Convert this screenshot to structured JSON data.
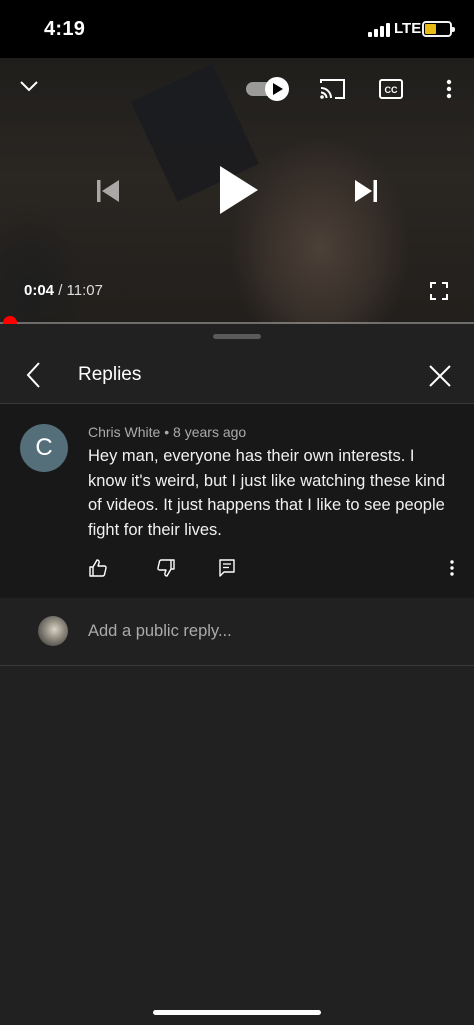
{
  "status_bar": {
    "time": "4:19",
    "network": "LTE"
  },
  "player": {
    "current_time": "0:04",
    "separator": " / ",
    "duration": "11:07",
    "progress": 0.006,
    "accent_color": "#ff0000",
    "icons": [
      "chevron-down-icon",
      "autoplay-toggle-icon",
      "cast-icon",
      "captions-icon",
      "more-icon",
      "previous-icon",
      "play-icon",
      "next-icon",
      "fullscreen-icon"
    ]
  },
  "replies_panel": {
    "title": "Replies",
    "comment": {
      "avatar_letter": "C",
      "author": "Chris White",
      "dot": " • ",
      "age": "8 years ago",
      "text": "Hey man, everyone has their own interests. I know it's weird, but I just like watching these kind of videos. It just happens that I like to see people fight for their lives."
    },
    "reply_placeholder": "Add a public reply..."
  }
}
